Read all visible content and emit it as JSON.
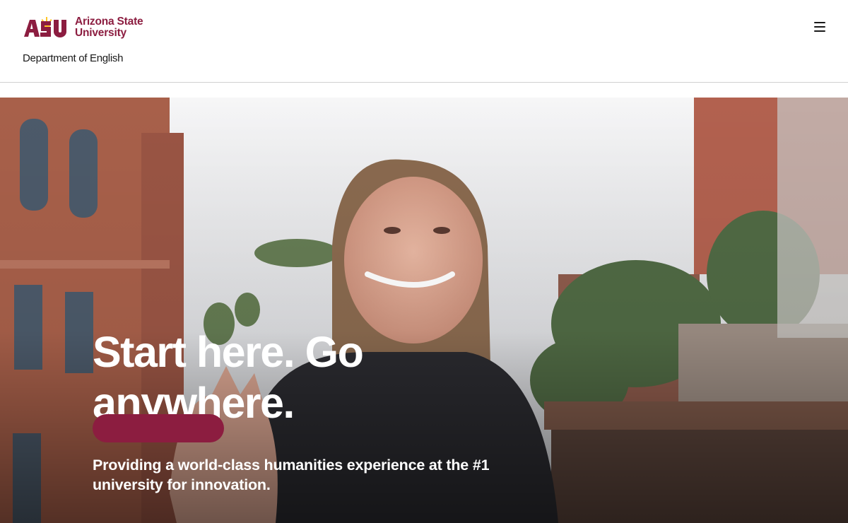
{
  "header": {
    "logo": {
      "mark": "ASU",
      "line1": "Arizona State",
      "line2": "University"
    },
    "department": "Department of English",
    "menu_icon": "hamburger-menu-icon"
  },
  "hero": {
    "title": "Start here. Go anywhere.",
    "subtitle": "Providing a world-class humanities experience at the #1 university for innovation.",
    "cta_label": ""
  },
  "colors": {
    "brand_maroon": "#8c1d40",
    "brand_gold": "#ffc627",
    "text_dark": "#191919"
  }
}
